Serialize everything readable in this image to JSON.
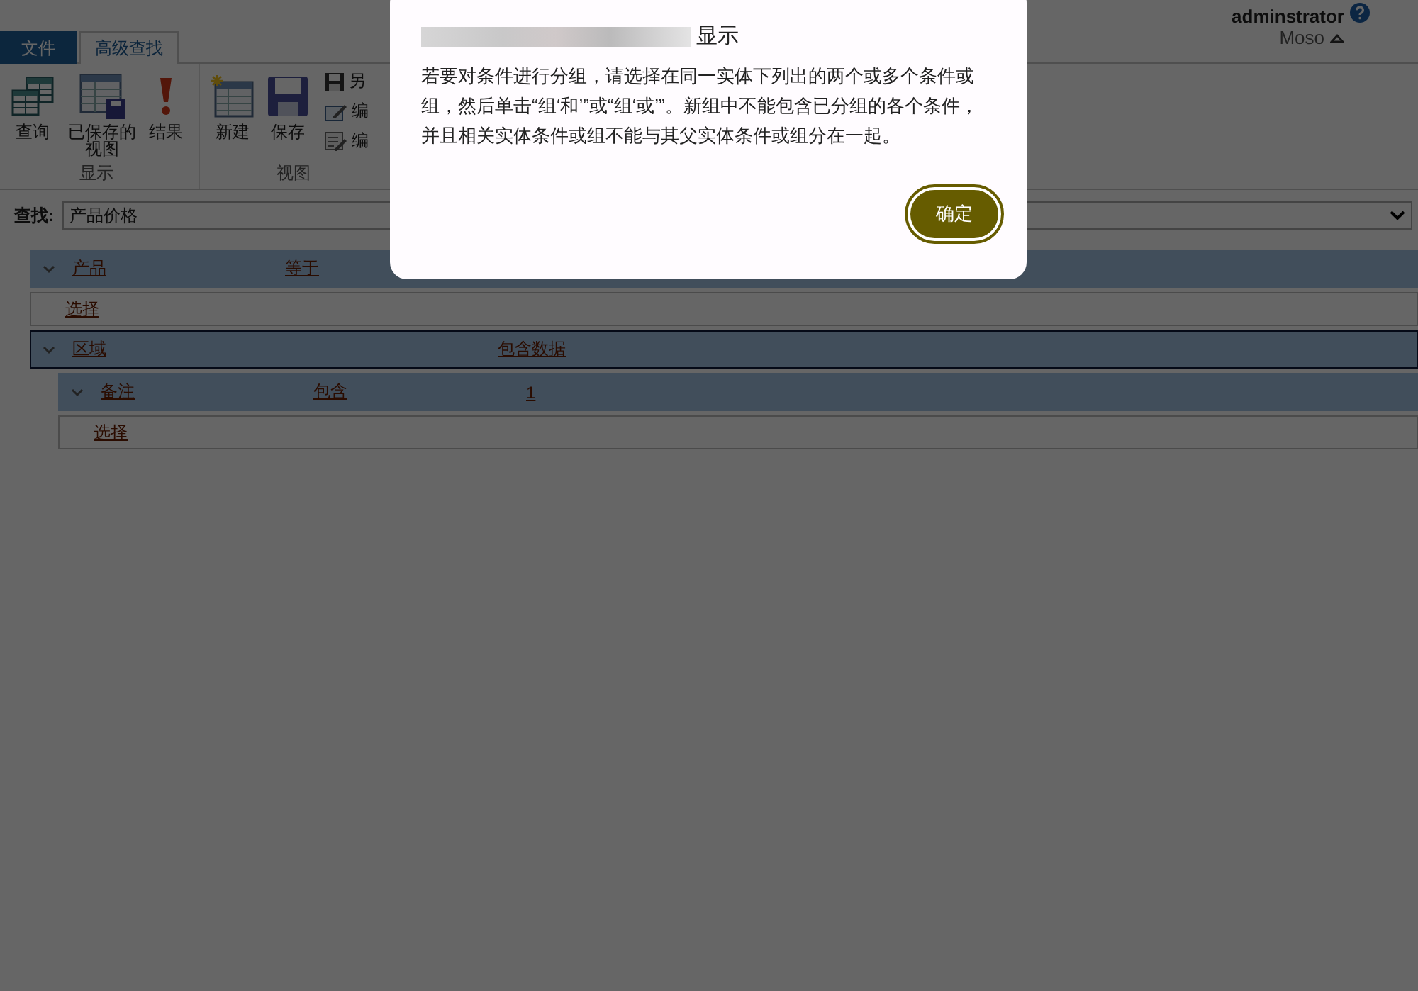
{
  "tabs": [
    {
      "label": "文件",
      "selected": false,
      "kind": "file"
    },
    {
      "label": "高级查找",
      "selected": true,
      "kind": "normal"
    }
  ],
  "user": {
    "name": "adminstrator",
    "org": "Moso"
  },
  "ribbon": {
    "groups": [
      {
        "label": "显示",
        "buttons": [
          {
            "label": "查询",
            "kind": "large"
          },
          {
            "label": "已保存的视图",
            "kind": "large"
          },
          {
            "label": "结果",
            "kind": "large"
          }
        ]
      },
      {
        "label": "视图",
        "buttons": [
          {
            "label": "新建",
            "kind": "large"
          },
          {
            "label": "保存",
            "kind": "large"
          },
          {
            "label": "另",
            "kind": "small"
          },
          {
            "label": "编",
            "kind": "small"
          },
          {
            "label": "编",
            "kind": "small"
          }
        ]
      }
    ]
  },
  "find": {
    "label": "查找:",
    "value": "产品价格"
  },
  "conditions": [
    {
      "kind": "condition",
      "field": "产品",
      "operator": "等于",
      "selected": false
    },
    {
      "kind": "select",
      "label": "选择"
    },
    {
      "kind": "condition",
      "field": "区域",
      "value": "包含数据",
      "selected": true,
      "children": [
        {
          "kind": "condition",
          "field": "备注",
          "operator": "包含",
          "value": "1",
          "selected": false
        },
        {
          "kind": "select",
          "label": "选择"
        }
      ]
    }
  ],
  "dialog": {
    "title": "显示",
    "message": "若要对条件进行分组，请选择在同一实体下列出的两个或多个条件或组，然后单击“组‘和’”或“组‘或’”。新组中不能包含已分组的各个条件，并且相关实体条件或组不能与其父实体条件或组分在一起。",
    "button": "确定"
  }
}
